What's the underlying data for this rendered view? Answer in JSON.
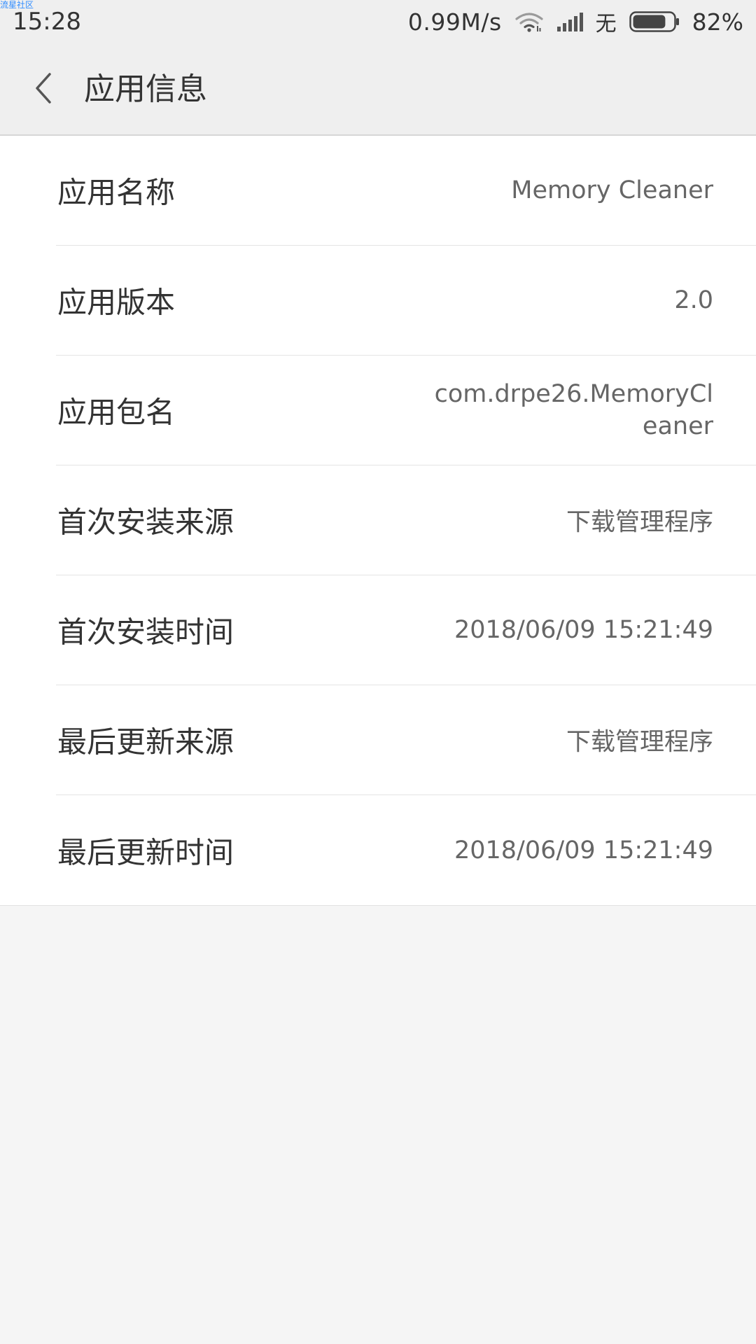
{
  "status_bar": {
    "watermark": "流星社区",
    "time": "15:28",
    "net_speed": "0.99M/s",
    "no_sim_label": "无",
    "battery_percent": "82%",
    "battery_level": 0.82
  },
  "header": {
    "title": "应用信息"
  },
  "info": {
    "rows": [
      {
        "label": "应用名称",
        "value": "Memory Cleaner"
      },
      {
        "label": "应用版本",
        "value": "2.0"
      },
      {
        "label": "应用包名",
        "value": "com.drpe26.MemoryCleaner"
      },
      {
        "label": "首次安装来源",
        "value": "下载管理程序"
      },
      {
        "label": "首次安装时间",
        "value": "2018/06/09 15:21:49"
      },
      {
        "label": "最后更新来源",
        "value": "下载管理程序"
      },
      {
        "label": "最后更新时间",
        "value": "2018/06/09 15:21:49"
      }
    ]
  },
  "colors": {
    "background": "#f5f5f5",
    "header_bg": "#efefef",
    "card_bg": "#ffffff",
    "label_text": "#333333",
    "value_text": "#666666",
    "watermark": "#2f8cff"
  },
  "icons": {
    "back": "chevron-left-icon",
    "wifi": "wifi-icon",
    "signal": "signal-icon",
    "battery": "battery-icon"
  }
}
